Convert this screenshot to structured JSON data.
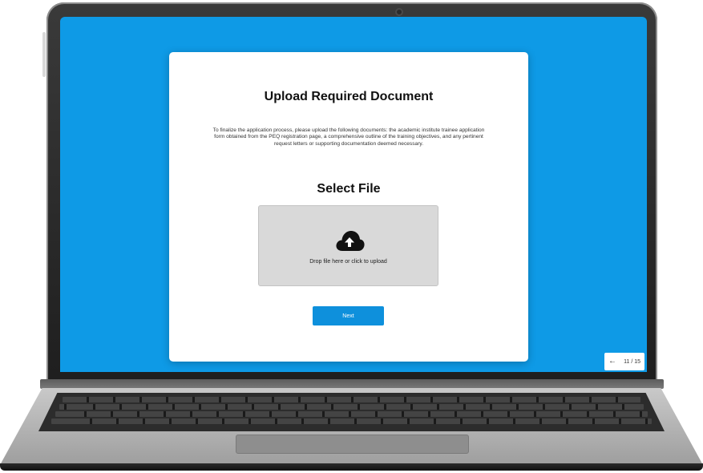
{
  "card": {
    "title": "Upload Required Document",
    "description": "To finalize the application process, please upload the following documents: the academic institute trainee application form obtained from the PEQ registration page, a comprehensive outline of the training objectives, and any pertinent request letters or supporting documentation deemed necessary.",
    "select_title": "Select File",
    "dropzone_text": "Drop file here or click to upload",
    "next_label": "Next"
  },
  "pager": {
    "back_icon": "←",
    "page_text": "11 / 15"
  },
  "icons": {
    "upload": "cloud-upload-icon",
    "back": "arrow-left-icon"
  },
  "colors": {
    "screen_background": "#0e9ae6",
    "button_background": "#0e90dc",
    "dropzone_background": "#d9d9d9"
  }
}
